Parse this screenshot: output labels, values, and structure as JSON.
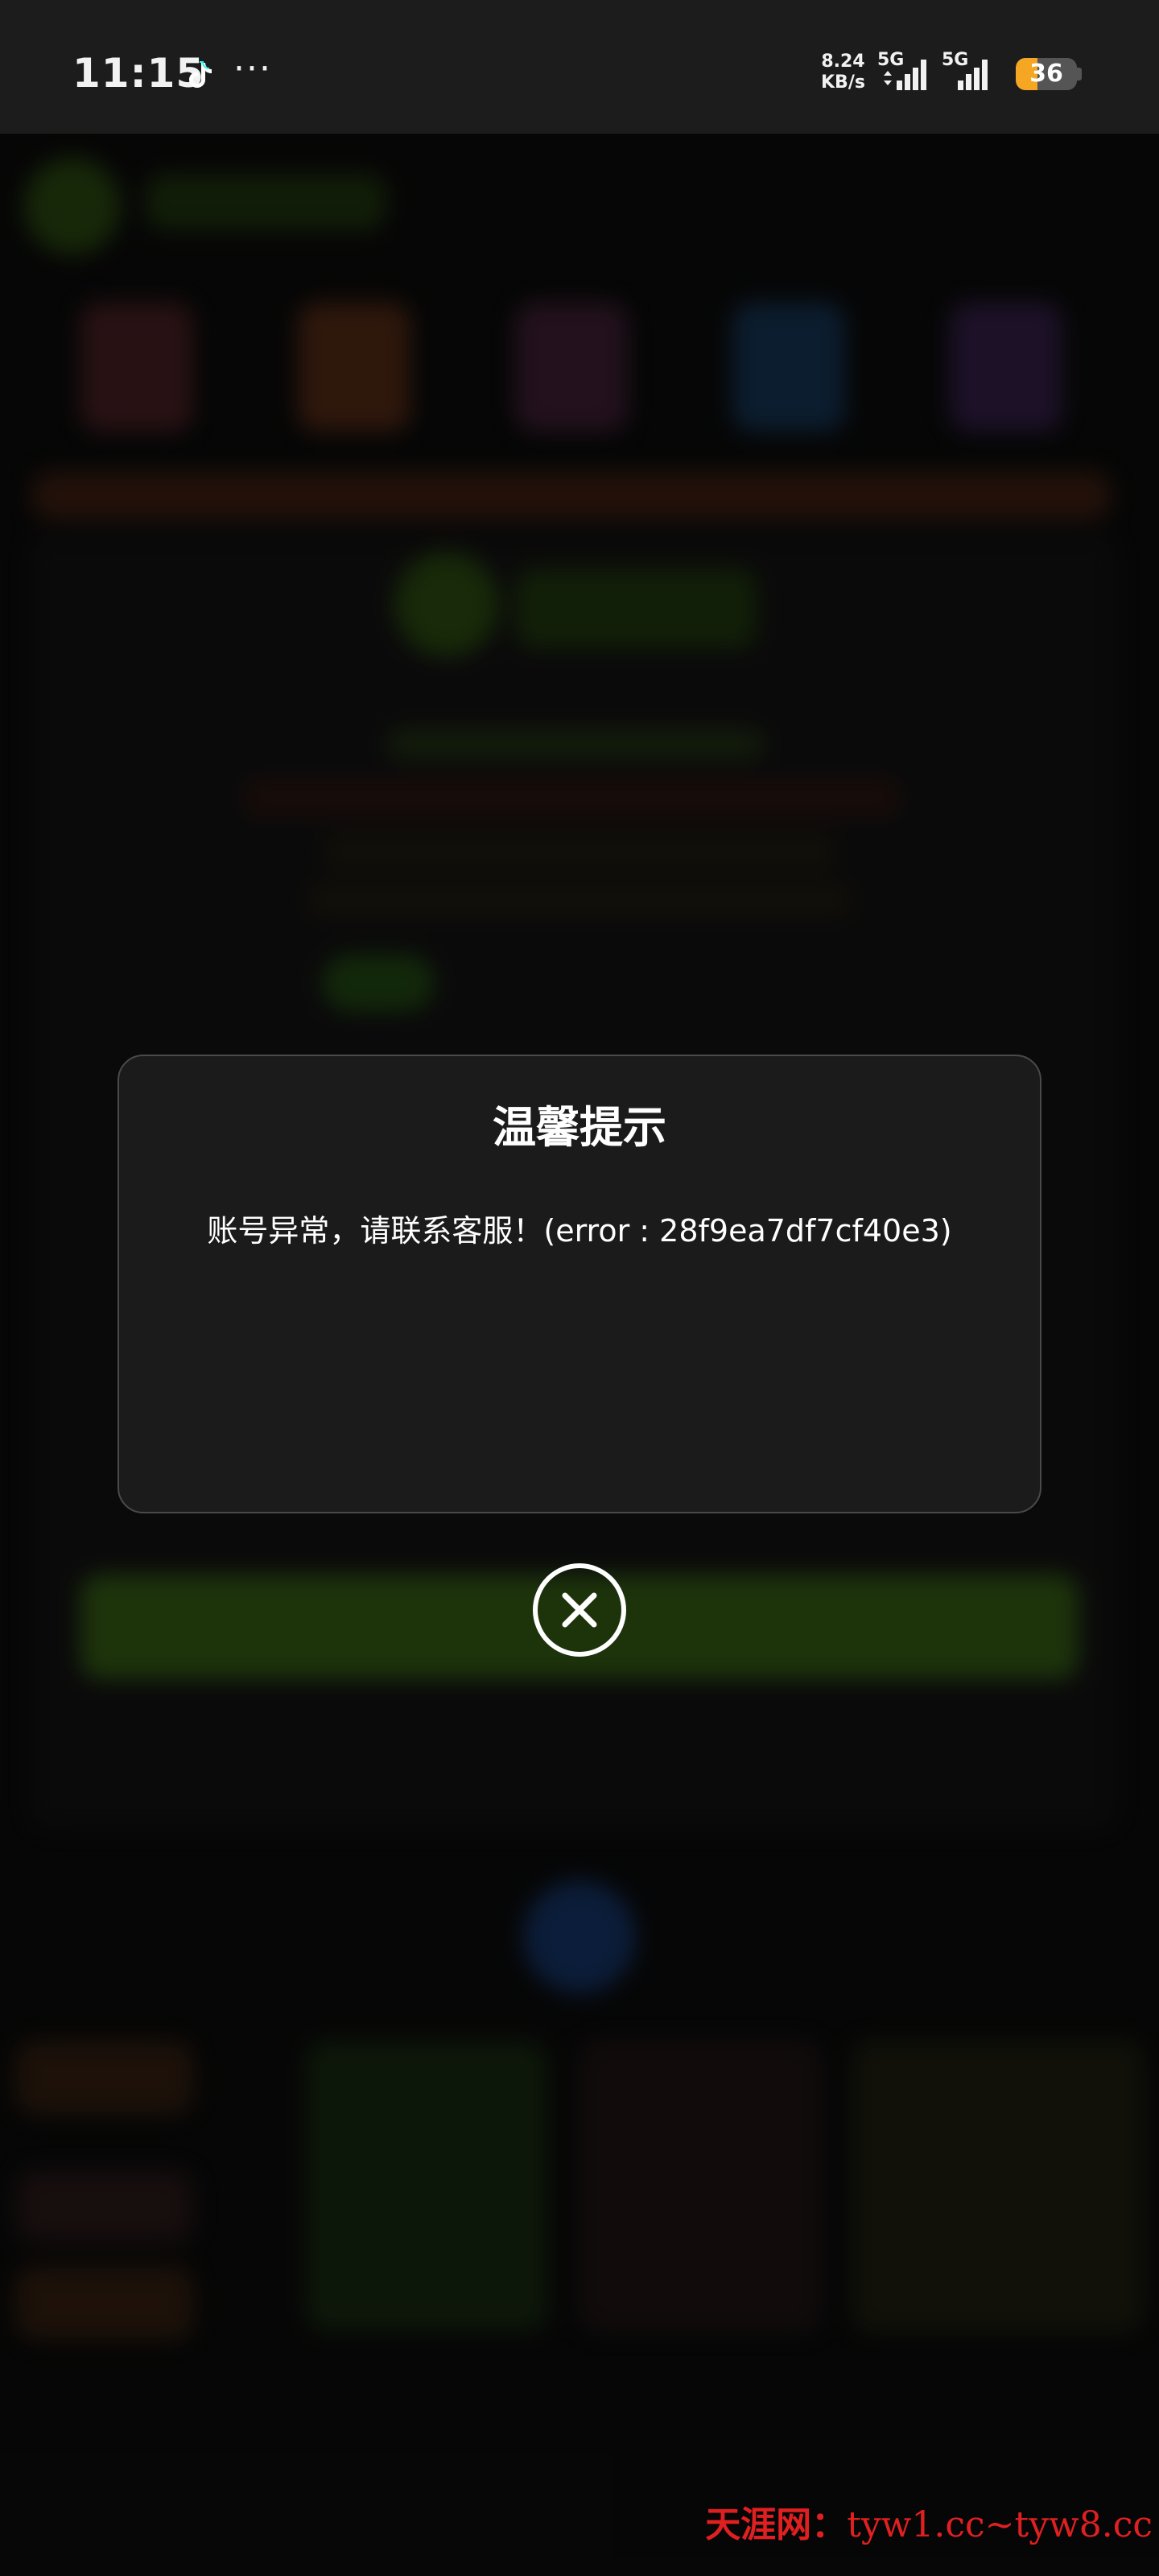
{
  "status_bar": {
    "time": "11:15",
    "app_icon": "tiktok-icon",
    "more": "···",
    "speed_value": "8.24",
    "speed_unit": "KB/s",
    "net1": "5G",
    "net2": "5G",
    "battery": "36",
    "battery_level_percent": 36,
    "battery_color": "#f5a623"
  },
  "dialog": {
    "title": "温馨提示",
    "message": "账号异常，请联系客服！(error : 28f9ea7df7cf40e3)",
    "close_icon": "close-circle-icon"
  },
  "watermark": {
    "name": "天涯网：",
    "url": "tyw1.cc~tyw8.cc",
    "color": "#e02020"
  }
}
